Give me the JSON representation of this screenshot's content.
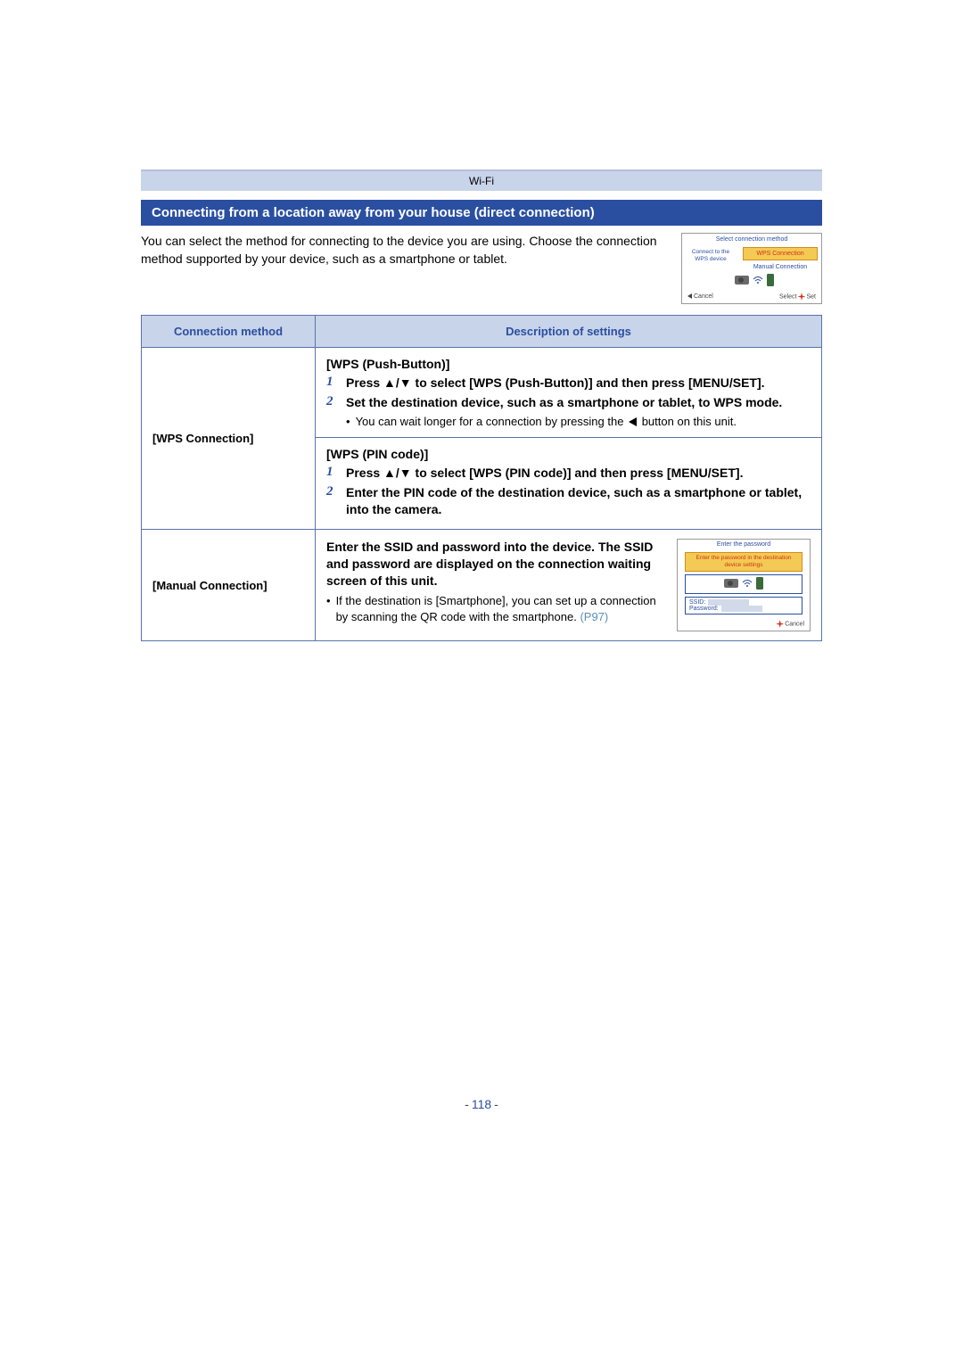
{
  "breadcrumb": "Wi-Fi",
  "section_title": "Connecting from a location away from your house (direct connection)",
  "intro": "You can select the method for connecting to the device you are using. Choose the connection method supported by your device, such as a smartphone or tablet.",
  "screen1": {
    "title": "Select connection method",
    "left_text": "Connect to the WPS device",
    "btn1": "WPS Connection",
    "btn2": "Manual Connection",
    "foot_cancel": "Cancel",
    "foot_select": "Select",
    "foot_set": "Set"
  },
  "table": {
    "header_method": "Connection method",
    "header_desc": "Description of settings",
    "rows": {
      "wps": {
        "method": "[WPS Connection]",
        "push": {
          "title": "[WPS (Push-Button)]",
          "step1": "Press ▲/▼ to select [WPS (Push-Button)] and then press [MENU/SET].",
          "step2": "Set the destination device, such as a smartphone or tablet, to WPS mode.",
          "note": "You can wait longer for a connection by pressing the",
          "note_after": "button on this unit."
        },
        "pin": {
          "title": "[WPS (PIN code)]",
          "step1": "Press ▲/▼ to select [WPS (PIN code)] and then press [MENU/SET].",
          "step2": "Enter the PIN code of the destination device, such as a smartphone or tablet, into the camera."
        }
      },
      "manual": {
        "method": "[Manual Connection]",
        "head": "Enter the SSID and password into the device. The SSID and password are displayed on the connection waiting screen of this unit.",
        "note": "If the destination is [Smartphone], you can set up a connection by scanning the QR code with the smartphone.",
        "link": "(P97)"
      }
    }
  },
  "screen2": {
    "title": "Enter the password",
    "sub": "Enter the password in the destination device settings",
    "ssid_label": "SSID:",
    "pw_label": "Password:",
    "cancel": "Cancel"
  },
  "page_number": "118"
}
